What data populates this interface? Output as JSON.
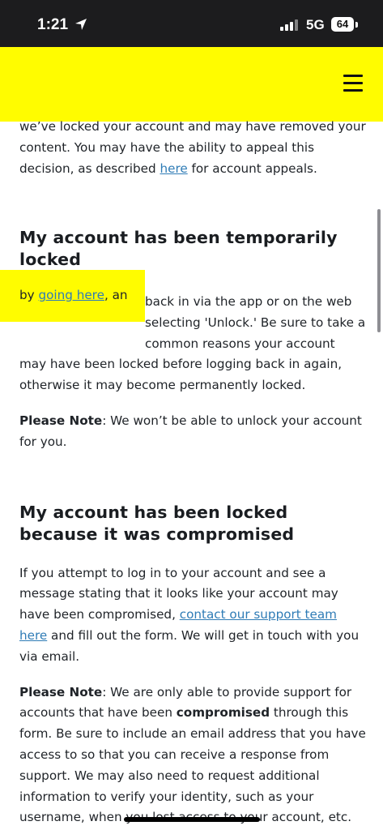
{
  "status_bar": {
    "time": "1:21",
    "network": "5G",
    "battery": "64"
  },
  "intro": {
    "text_before": "we’ve locked your account and may have removed your content. You may have the ability to appeal this decision, as described ",
    "link": "here",
    "text_after": " for account appeals."
  },
  "section_temp": {
    "heading": "My account has been temporarily locked",
    "line1_tail": "back in via the app or on the web",
    "line2_mid": "selecting 'Unlock.' Be sure to take a",
    "line3_tail": "common reasons your account",
    "rest": "may have been locked before logging back in again, otherwise it may become permanently locked.",
    "redacted_by": "by ",
    "redacted_link": "going here",
    "redacted_after": ", an",
    "note_label": "Please Note",
    "note_text": ": We won’t be able to unlock your account for you."
  },
  "section_comp": {
    "heading": "My account has been locked because it was compromised",
    "p1_before": "If you attempt to log in to your account and see a message stating that it looks like your account may have been compromised, ",
    "p1_link": "contact our support team here",
    "p1_after": " and fill out the form. We will get in touch with you via email.",
    "note_label": "Please Note",
    "note_before": ": We are only able to provide support for accounts that have been ",
    "note_bold": "compromised",
    "note_after": " through this form. Be sure to include an email address that you have access to so that you can receive a response from support. We may also need to request additional information to verify your identity, such as your username, when you lost access to your account, etc."
  },
  "colors": {
    "header_yellow": "#fffc00",
    "link_blue": "#2f7cb6"
  }
}
